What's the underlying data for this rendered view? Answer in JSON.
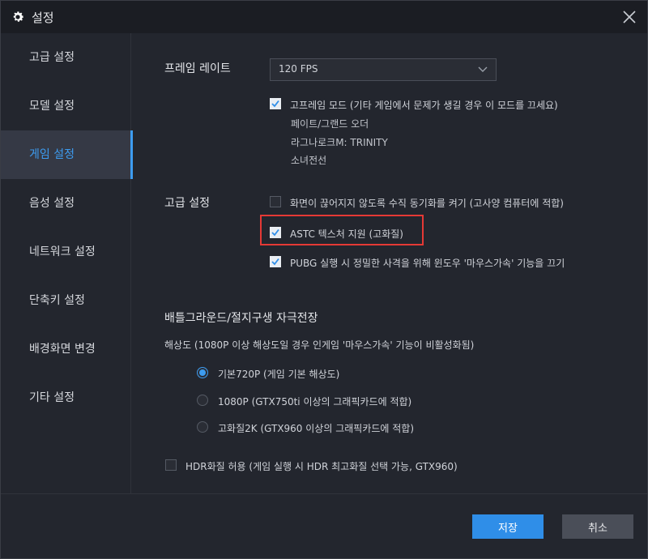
{
  "window": {
    "title": "설정"
  },
  "sidebar": {
    "items": [
      {
        "label": "고급 설정",
        "active": false
      },
      {
        "label": "모델 설정",
        "active": false
      },
      {
        "label": "게임 설정",
        "active": true
      },
      {
        "label": "음성 설정",
        "active": false
      },
      {
        "label": "네트워크 설정",
        "active": false
      },
      {
        "label": "단축키 설정",
        "active": false
      },
      {
        "label": "배경화면 변경",
        "active": false
      },
      {
        "label": "기타 설정",
        "active": false
      }
    ]
  },
  "frame_rate": {
    "label": "프레임 레이트",
    "selected": "120 FPS",
    "high_frame_mode": {
      "label": "고프레임 모드  (기타 게임에서 문제가 생길 경우 이 모드를 끄세요)",
      "checked": true
    },
    "games": [
      "페이트/그랜드 오더",
      "라그나로크M: TRINITY",
      "소녀전선"
    ]
  },
  "advanced": {
    "label": "고급 설정",
    "vsync": {
      "label": "화면이 끊어지지 않도록 수직 동기화를 켜기  (고사양 컴퓨터에 적합)",
      "checked": false
    },
    "astc": {
      "label": "ASTC 텍스처 지원 (고화질)",
      "checked": true
    },
    "pubg": {
      "label": "PUBG 실행 시 정밀한 사격을 위해 윈도우 '마우스가속' 기능을 끄기",
      "checked": true
    }
  },
  "battleground": {
    "title": "배틀그라운드/절지구생 자극전장",
    "resolution_note": "해상도 (1080P 이상 해상도일 경우 인게임  '마우스가속' 기능이 비활성화됨)",
    "options": [
      {
        "label": "기본720P (게임 기본 해상도)",
        "selected": true
      },
      {
        "label": "1080P (GTX750ti 이상의 그래픽카드에 적합)",
        "selected": false
      },
      {
        "label": "고화질2K (GTX960 이상의 그래픽카드에 적합)",
        "selected": false
      }
    ],
    "hdr": {
      "label": "HDR화질 허용 (게임 실행 시 HDR 최고화질 선택 가능, GTX960)",
      "checked": false
    }
  },
  "footer": {
    "save": "저장",
    "cancel": "취소"
  },
  "colors": {
    "accent": "#3d9cf0",
    "highlight": "#e53935",
    "save_button": "#2f8ee8"
  }
}
